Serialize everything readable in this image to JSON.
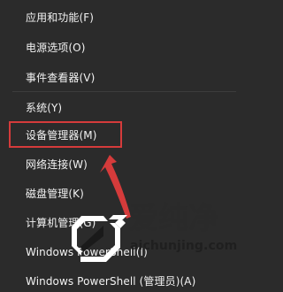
{
  "menu": {
    "items": [
      {
        "label": "应用和功能(F)"
      },
      {
        "label": "电源选项(O)"
      },
      {
        "label": "事件查看器(V)"
      },
      {
        "label": "系统(Y)"
      },
      {
        "label": "设备管理器(M)"
      },
      {
        "label": "网络连接(W)"
      },
      {
        "label": "磁盘管理(K)"
      },
      {
        "label": "计算机管理(G)"
      },
      {
        "label": "Windows PowerShell(I)"
      },
      {
        "label": "Windows PowerShell (管理员)(A)"
      }
    ],
    "highlighted_item": "设备管理器(M)"
  },
  "annotation": {
    "box_color": "#d53b3b",
    "arrow_color": "#d53b3b"
  },
  "watermark": {
    "title": "爱纯净",
    "url": "aichunjing.com"
  },
  "colors": {
    "background": "#2b2b2b",
    "text": "#f2f2f2",
    "highlight": "#d53b3b"
  }
}
